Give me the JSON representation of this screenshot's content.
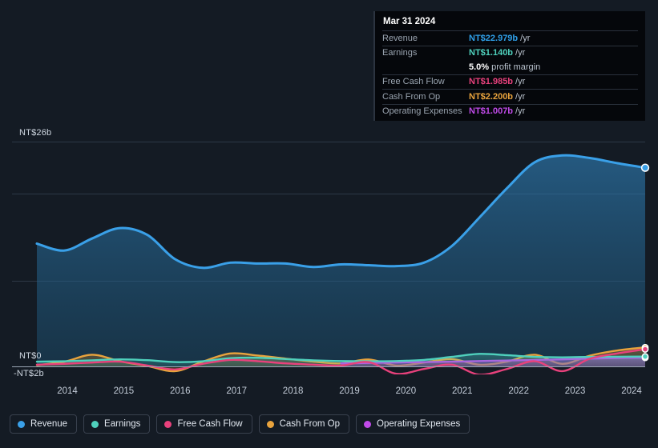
{
  "tooltip": {
    "date": "Mar 31 2024",
    "rows": [
      {
        "label": "Revenue",
        "value": "NT$22.979b",
        "unit": "/yr",
        "color": "#2f9fe8"
      },
      {
        "label": "Earnings",
        "value": "NT$1.140b",
        "unit": "/yr",
        "color": "#4fd1bd"
      },
      {
        "label": "",
        "value": "5.0%",
        "unit": "profit margin",
        "color": "#ffffff"
      },
      {
        "label": "Free Cash Flow",
        "value": "NT$1.985b",
        "unit": "/yr",
        "color": "#e8417c"
      },
      {
        "label": "Cash From Op",
        "value": "NT$2.200b",
        "unit": "/yr",
        "color": "#e8a33d"
      },
      {
        "label": "Operating Expenses",
        "value": "NT$1.007b",
        "unit": "/yr",
        "color": "#c04ae8"
      }
    ]
  },
  "axis": {
    "y_top": "NT$26b",
    "y_zero": "NT$0",
    "y_bottom": "-NT$2b",
    "x_ticks": [
      "2014",
      "2015",
      "2016",
      "2017",
      "2018",
      "2019",
      "2020",
      "2021",
      "2022",
      "2023",
      "2024"
    ]
  },
  "legend": {
    "items": [
      {
        "label": "Revenue",
        "color": "#3aa0e8"
      },
      {
        "label": "Earnings",
        "color": "#4fd1bd"
      },
      {
        "label": "Free Cash Flow",
        "color": "#e8417c"
      },
      {
        "label": "Cash From Op",
        "color": "#e8a33d"
      },
      {
        "label": "Operating Expenses",
        "color": "#c04ae8"
      }
    ]
  },
  "chart_data": {
    "type": "area",
    "title": "",
    "xlabel": "",
    "ylabel": "NT$ (billions)",
    "ylim": [
      -2,
      26
    ],
    "grid": true,
    "legend_position": "bottom",
    "currency": "NT$",
    "x": [
      "2013.5",
      "2014",
      "2014.5",
      "2015",
      "2015.5",
      "2016",
      "2016.5",
      "2017",
      "2017.5",
      "2018",
      "2018.5",
      "2019",
      "2019.5",
      "2020",
      "2020.5",
      "2021",
      "2021.5",
      "2022",
      "2022.5",
      "2023",
      "2023.5",
      "2024",
      "2024.25"
    ],
    "series": [
      {
        "name": "Revenue",
        "color": "#3aa0e8",
        "values": [
          14.2,
          13.4,
          14.8,
          16.0,
          15.2,
          12.4,
          11.4,
          12.0,
          11.9,
          11.9,
          11.5,
          11.8,
          11.7,
          11.6,
          12.0,
          13.9,
          17.2,
          20.6,
          23.6,
          24.4,
          24.1,
          23.5,
          22.979
        ]
      },
      {
        "name": "Earnings",
        "color": "#4fd1bd",
        "values": [
          0.55,
          0.6,
          0.7,
          0.82,
          0.72,
          0.5,
          0.6,
          0.95,
          1.0,
          0.85,
          0.7,
          0.62,
          0.6,
          0.62,
          0.75,
          1.1,
          1.45,
          1.3,
          1.1,
          1.05,
          1.1,
          1.12,
          1.14
        ]
      },
      {
        "name": "Free Cash Flow",
        "color": "#e8417c",
        "values": [
          0.2,
          0.3,
          0.45,
          0.55,
          0.1,
          -0.35,
          0.3,
          0.75,
          0.6,
          0.35,
          0.2,
          0.1,
          0.5,
          -0.85,
          -0.3,
          0.2,
          -0.95,
          -0.3,
          0.6,
          -0.55,
          0.9,
          1.5,
          1.985
        ]
      },
      {
        "name": "Cash From Op",
        "color": "#e8a33d",
        "values": [
          0.15,
          0.55,
          1.35,
          0.6,
          0.05,
          -0.55,
          0.55,
          1.5,
          1.25,
          0.9,
          0.55,
          0.35,
          0.8,
          0.1,
          0.45,
          0.85,
          0.2,
          0.55,
          1.35,
          0.3,
          1.25,
          1.85,
          2.2
        ]
      },
      {
        "name": "Operating Expenses",
        "color": "#c04ae8",
        "values": [
          null,
          null,
          null,
          null,
          null,
          null,
          null,
          null,
          null,
          null,
          null,
          0.35,
          0.4,
          0.45,
          0.5,
          0.55,
          0.62,
          0.68,
          0.75,
          0.82,
          0.9,
          0.97,
          1.007
        ]
      }
    ]
  }
}
